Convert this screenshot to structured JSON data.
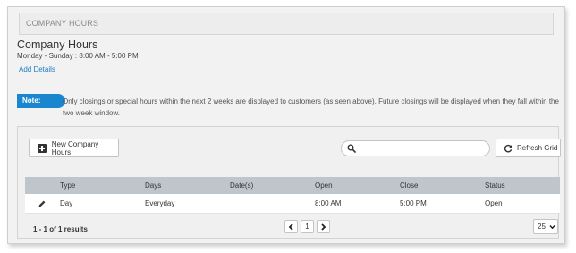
{
  "header": {
    "title": "COMPANY HOURS"
  },
  "summary": {
    "title": "Company Hours",
    "hours_line": "Monday - Sunday : 8:00 AM - 5:00 PM",
    "add_details_link": "Add Details"
  },
  "note": {
    "badge": "Note:",
    "text": "Only closings or special hours within the next 2 weeks are displayed to customers (as seen above). Future closings will be displayed when they fall within the two week window."
  },
  "toolbar": {
    "new_button": "New Company Hours",
    "search_value": "",
    "refresh_button": "Refresh Grid"
  },
  "table": {
    "columns": [
      "Type",
      "Days",
      "Date(s)",
      "Open",
      "Close",
      "Status"
    ],
    "rows": [
      {
        "type": "Day",
        "days": "Everyday",
        "dates": "",
        "open": "8:00 AM",
        "close": "5:00 PM",
        "status": "Open"
      }
    ]
  },
  "footer": {
    "results": "1 - 1 of 1 results",
    "current_page": "1",
    "page_size": "25"
  },
  "colors": {
    "accent": "#1a86d0",
    "link": "#1a7fc1",
    "table_header": "#bec5cc"
  }
}
